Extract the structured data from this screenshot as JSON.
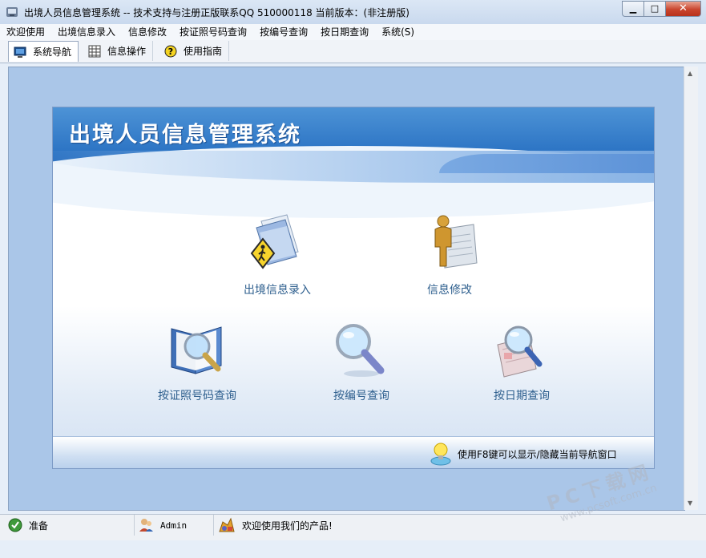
{
  "window": {
    "title": "出境人员信息管理系统 -- 技术支持与注册正版联系QQ 510000118    当前版本：(非注册版)",
    "minimize_glyph": "▁",
    "maximize_glyph": "□",
    "close_glyph": "✕"
  },
  "menu": [
    "欢迎使用",
    "出境信息录入",
    "信息修改",
    "按证照号码查询",
    "按编号查询",
    "按日期查询",
    "系统(S)"
  ],
  "tabs": [
    {
      "label": "系统导航",
      "icon": "monitor-icon",
      "active": true
    },
    {
      "label": "信息操作",
      "icon": "grid-icon",
      "active": false
    },
    {
      "label": "使用指南",
      "icon": "help-icon",
      "active": false
    }
  ],
  "panel": {
    "title": "出境人员信息管理系统",
    "nav": [
      {
        "label": "出境信息录入",
        "icon": "folder-pedestrian-icon"
      },
      {
        "label": "信息修改",
        "icon": "person-document-icon"
      },
      {
        "label": "按证照号码查询",
        "icon": "book-magnifier-icon"
      },
      {
        "label": "按编号查询",
        "icon": "magnifier-icon"
      },
      {
        "label": "按日期查询",
        "icon": "calendar-magnifier-icon"
      }
    ],
    "hint": "使用F8键可以显示/隐藏当前导航窗口"
  },
  "status": {
    "ready": "准备",
    "user": "Admin",
    "message": "欢迎使用我们的产品!"
  },
  "watermark": {
    "main": "PC下载网",
    "sub": "www.pcsoft.com.cn"
  },
  "colors": {
    "banner": "#2a72c3",
    "workspace": "#aac6e8",
    "label_text": "#2e5f8e"
  }
}
